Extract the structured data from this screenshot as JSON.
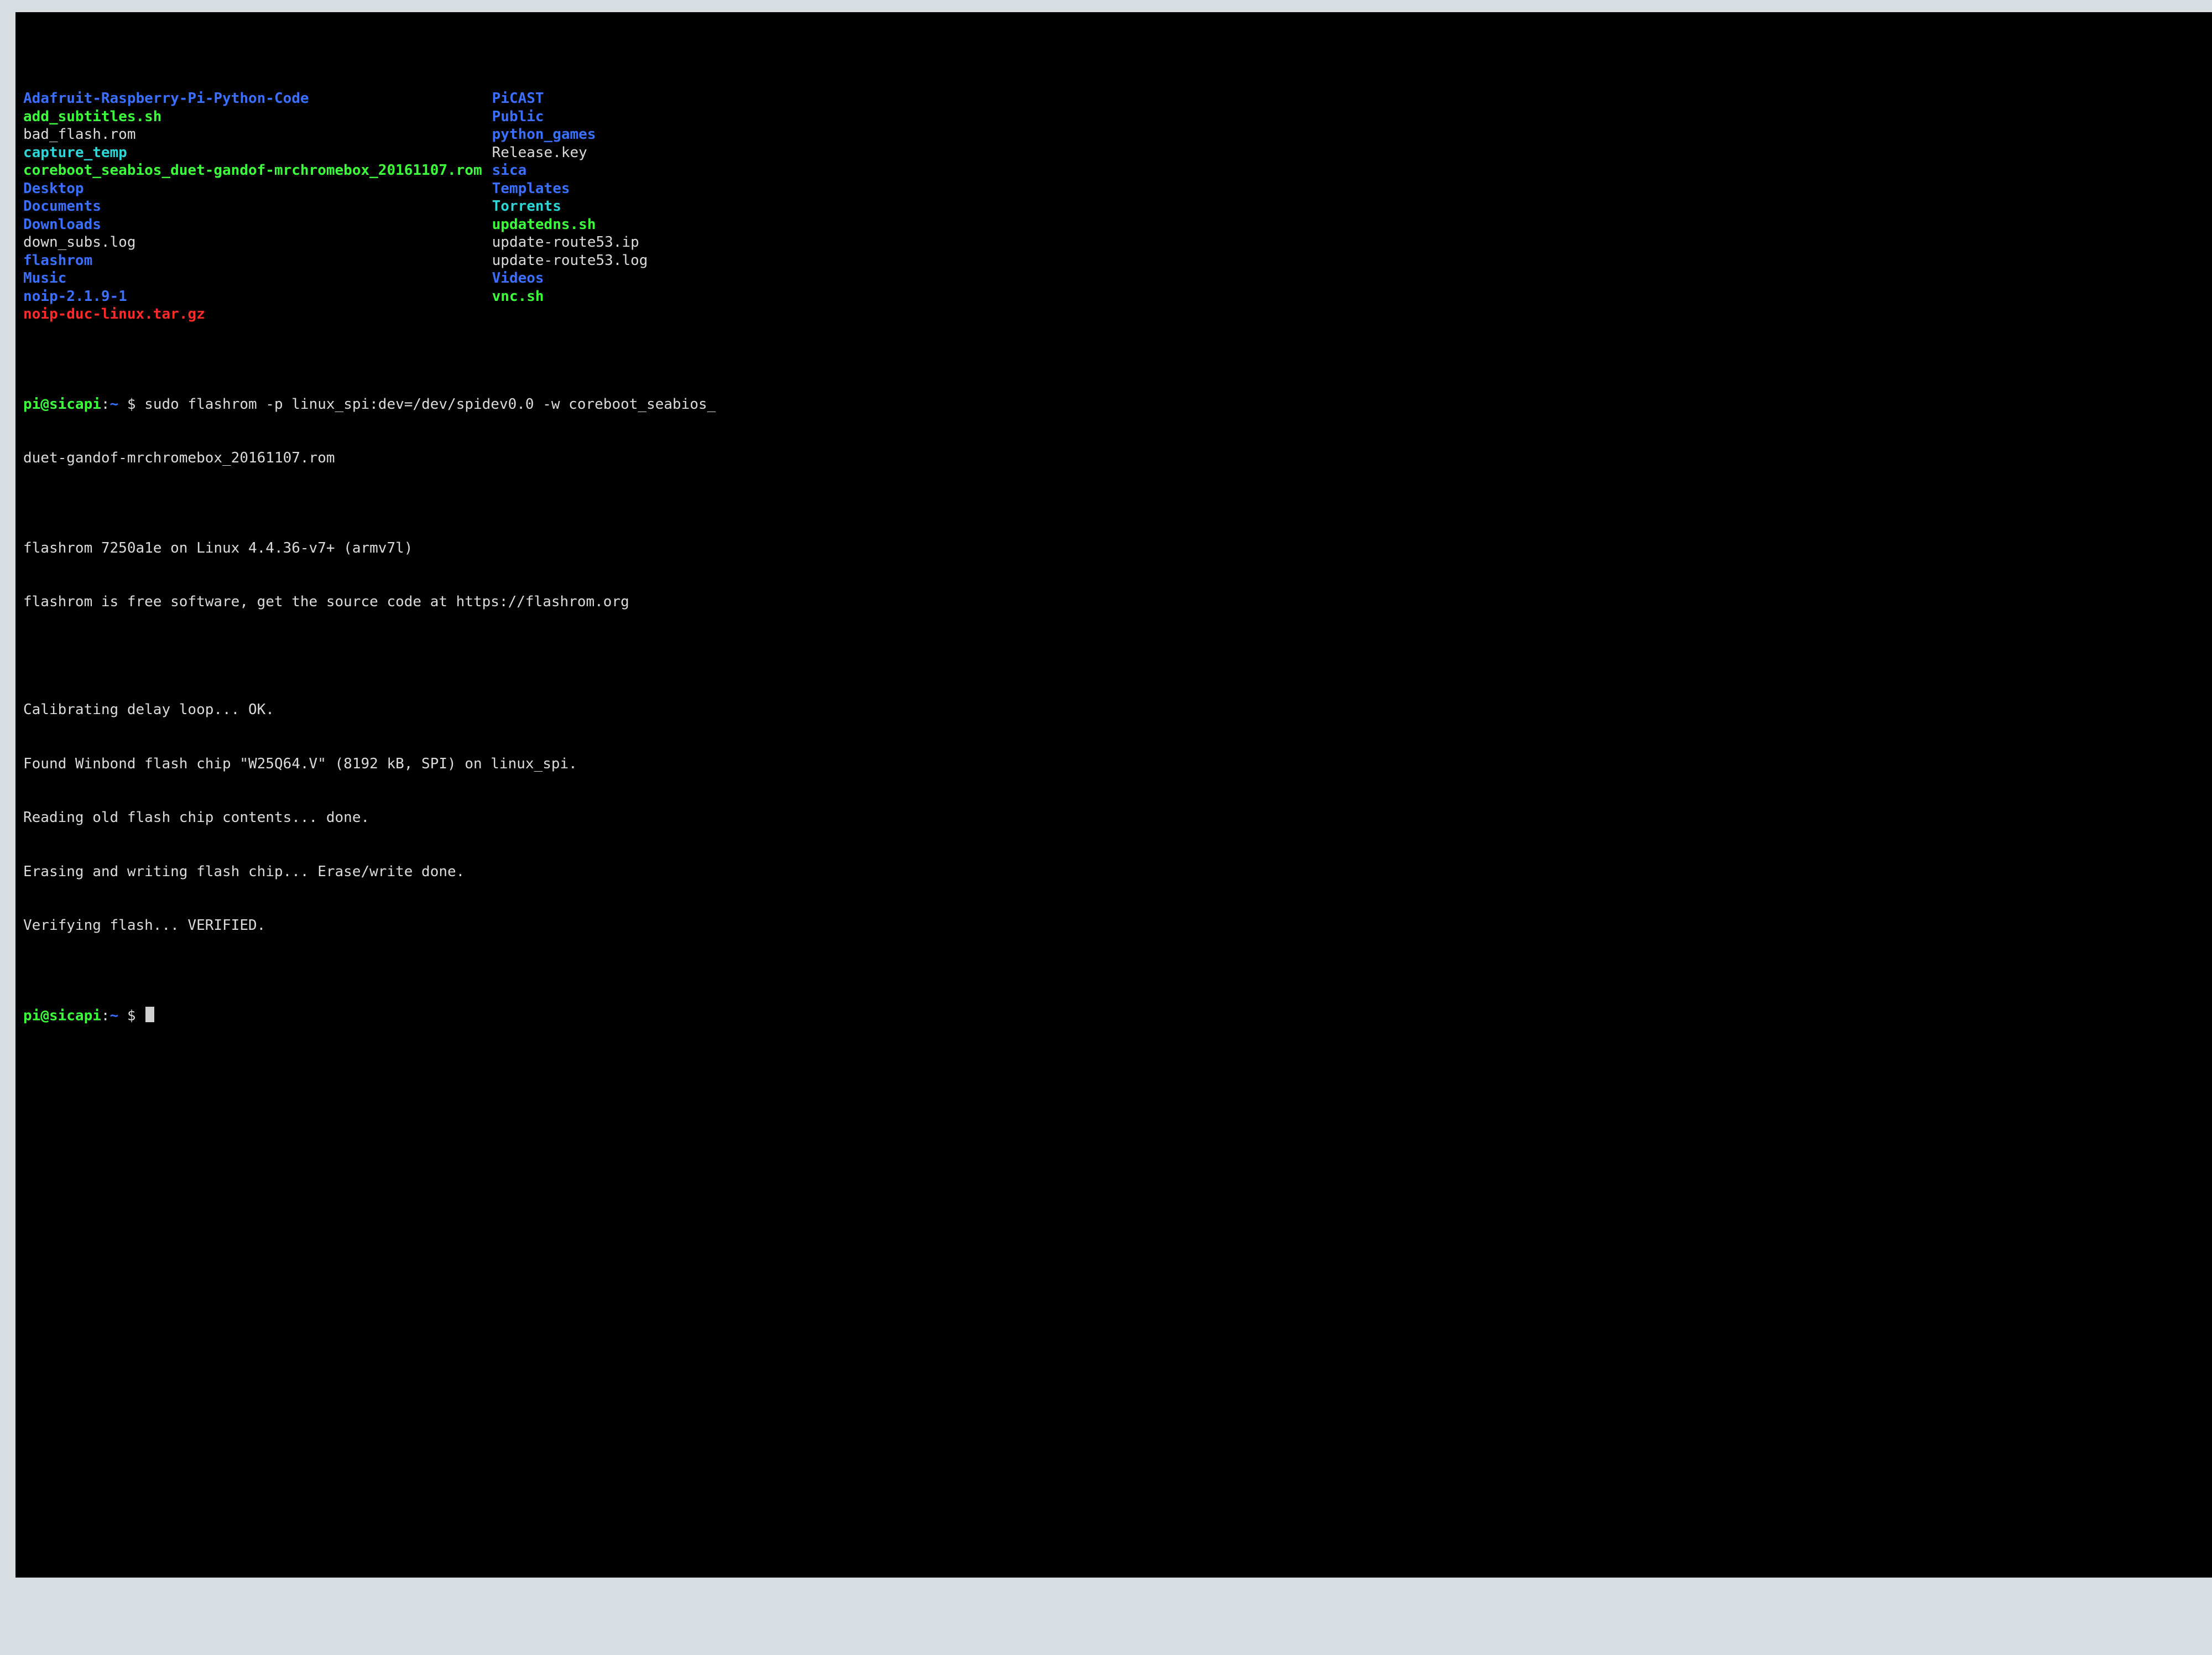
{
  "ls": {
    "left": [
      {
        "text": "Adafruit-Raspberry-Pi-Python-Code",
        "cls": "blue"
      },
      {
        "text": "add_subtitles.sh",
        "cls": "green"
      },
      {
        "text": "bad_flash.rom",
        "cls": "white"
      },
      {
        "text": "capture_temp",
        "cls": "cyan"
      },
      {
        "text": "coreboot_seabios_duet-gandof-mrchromebox_20161107.rom",
        "cls": "green"
      },
      {
        "text": "Desktop",
        "cls": "blue"
      },
      {
        "text": "Documents",
        "cls": "blue"
      },
      {
        "text": "Downloads",
        "cls": "blue"
      },
      {
        "text": "down_subs.log",
        "cls": "white"
      },
      {
        "text": "flashrom",
        "cls": "blue"
      },
      {
        "text": "Music",
        "cls": "blue"
      },
      {
        "text": "noip-2.1.9-1",
        "cls": "blue"
      },
      {
        "text": "noip-duc-linux.tar.gz",
        "cls": "red"
      }
    ],
    "right": [
      {
        "text": "",
        "cls": "white"
      },
      {
        "text": "PiCAST",
        "cls": "blue"
      },
      {
        "text": "Public",
        "cls": "blue"
      },
      {
        "text": "python_games",
        "cls": "blue"
      },
      {
        "text": "Release.key",
        "cls": "white"
      },
      {
        "text": "sica",
        "cls": "blue"
      },
      {
        "text": "Templates",
        "cls": "blue"
      },
      {
        "text": "Torrents",
        "cls": "cyan"
      },
      {
        "text": "updatedns.sh",
        "cls": "green"
      },
      {
        "text": "update-route53.ip",
        "cls": "white"
      },
      {
        "text": "update-route53.log",
        "cls": "white"
      },
      {
        "text": "Videos",
        "cls": "blue"
      },
      {
        "text": "vnc.sh",
        "cls": "green"
      }
    ]
  },
  "prompt": {
    "user": "pi@sicapi",
    "sep": ":",
    "path": "~",
    "sigil": " $ "
  },
  "cmd": {
    "line1": "sudo flashrom -p linux_spi:dev=/dev/spidev0.0 -w coreboot_seabios_",
    "line2": "duet-gandof-mrchromebox_20161107.rom"
  },
  "output": [
    "flashrom 7250a1e on Linux 4.4.36-v7+ (armv7l)",
    "flashrom is free software, get the source code at https://flashrom.org",
    "",
    "Calibrating delay loop... OK.",
    "Found Winbond flash chip \"W25Q64.V\" (8192 kB, SPI) on linux_spi.",
    "Reading old flash chip contents... done.",
    "Erasing and writing flash chip... Erase/write done.",
    "Verifying flash... VERIFIED."
  ]
}
